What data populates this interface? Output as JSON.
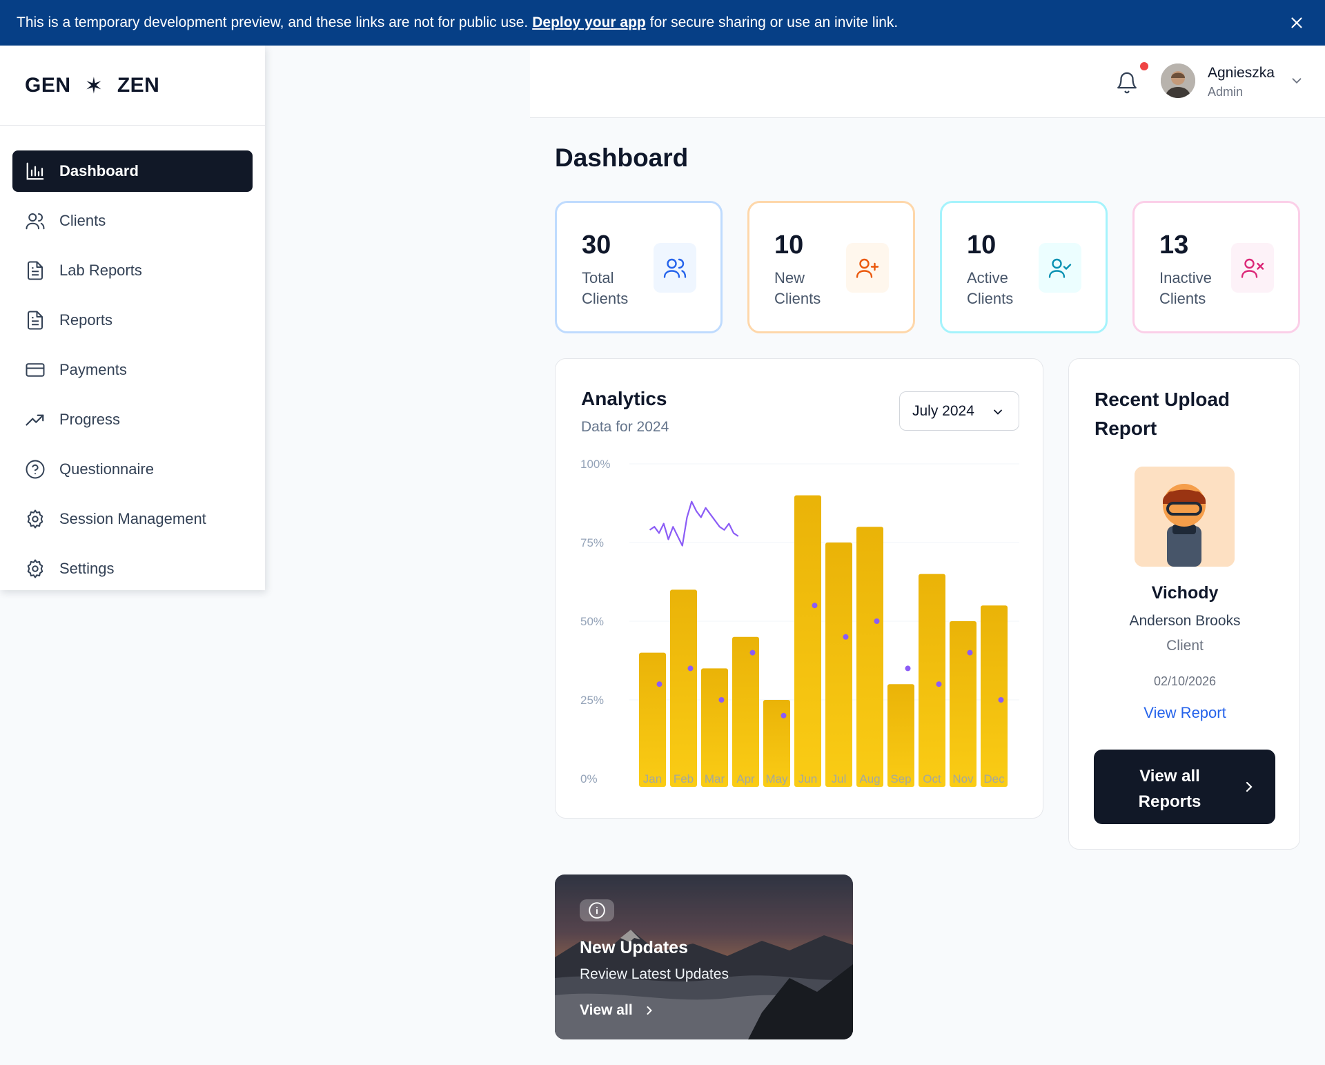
{
  "banner": {
    "text_before": "This is a temporary development preview, and these links are not for public use.",
    "link": "Deploy your app",
    "text_after": "for secure sharing or use an invite link."
  },
  "logo": {
    "left": "GEN",
    "symbol": "✶",
    "right": "ZEN"
  },
  "nav": [
    {
      "label": "Dashboard",
      "icon": "bar-chart-icon",
      "active": true
    },
    {
      "label": "Clients",
      "icon": "users-icon"
    },
    {
      "label": "Lab Reports",
      "icon": "file-text-icon"
    },
    {
      "label": "Reports",
      "icon": "file-text-icon"
    },
    {
      "label": "Payments",
      "icon": "credit-card-icon"
    },
    {
      "label": "Progress",
      "icon": "trending-up-icon"
    },
    {
      "label": "Questionnaire",
      "icon": "help-circle-icon"
    },
    {
      "label": "Session Management",
      "icon": "gear-icon"
    },
    {
      "label": "Settings",
      "icon": "gear-icon"
    }
  ],
  "user": {
    "name": "Agnieszka",
    "role": "Admin"
  },
  "page_title": "Dashboard",
  "stats": [
    {
      "value": "30",
      "line1": "Total",
      "line2": "Clients",
      "icon": "users-icon",
      "color": "#2563eb",
      "border": "#bfdbfe",
      "bg": "#eff6ff"
    },
    {
      "value": "10",
      "line1": "New",
      "line2": "Clients",
      "icon": "user-plus-icon",
      "color": "#ea580c",
      "border": "#fed7aa",
      "bg": "#fff7ed"
    },
    {
      "value": "10",
      "line1": "Active",
      "line2": "Clients",
      "icon": "user-check-icon",
      "color": "#0891b2",
      "border": "#a5f3fc",
      "bg": "#ecfeff"
    },
    {
      "value": "13",
      "line1": "Inactive",
      "line2": "Clients",
      "icon": "user-x-icon",
      "color": "#db2777",
      "border": "#fbcfe8",
      "bg": "#fdf2f8"
    }
  ],
  "analytics": {
    "title": "Analytics",
    "subtitle": "Data for 2024",
    "month_select": "July 2024"
  },
  "chart_data": {
    "type": "bar",
    "categories": [
      "Jan",
      "Feb",
      "Mar",
      "Apr",
      "May",
      "Jun",
      "Jul",
      "Aug",
      "Sep",
      "Oct",
      "Nov",
      "Dec"
    ],
    "ylim": [
      0,
      100
    ],
    "yticks": [
      "0%",
      "25%",
      "50%",
      "75%",
      "100%"
    ],
    "grid": true,
    "series": [
      {
        "kind": "bar",
        "values": [
          40,
          60,
          35,
          45,
          25,
          90,
          75,
          80,
          30,
          65,
          50,
          55
        ],
        "color": "#eab308"
      },
      {
        "kind": "scatter",
        "values": [
          30,
          35,
          25,
          40,
          20,
          55,
          45,
          50,
          35,
          30,
          40,
          25
        ],
        "color": "#8b5cf6"
      },
      {
        "kind": "line",
        "x": [
          0,
          0.15,
          0.3,
          0.45,
          0.6,
          0.75,
          0.9,
          1.05,
          1.2,
          1.35,
          1.5,
          1.65,
          1.8,
          1.95,
          2.1,
          2.25,
          2.4,
          2.55,
          2.7,
          2.85
        ],
        "values": [
          79,
          80,
          78,
          81,
          76,
          80,
          77,
          74,
          83,
          88,
          85,
          83,
          86,
          84,
          82,
          80,
          79,
          81,
          78,
          77
        ],
        "color": "#8b5cf6"
      }
    ]
  },
  "recent_upload": {
    "title": "Recent Upload Report",
    "name": "Vichody",
    "person": "Anderson Brooks",
    "role": "Client",
    "date": "02/10/2026",
    "link": "View Report",
    "button": "View all Reports"
  },
  "updates": {
    "title": "New Updates",
    "subtitle": "Review Latest Updates",
    "link": "View all"
  }
}
